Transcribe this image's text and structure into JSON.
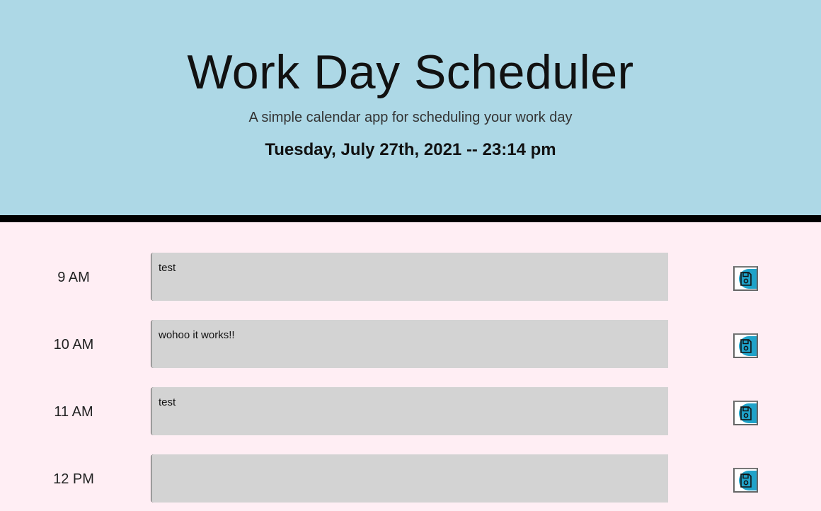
{
  "header": {
    "title": "Work Day Scheduler",
    "subtitle": "A simple calendar app for scheduling your work day",
    "current_day": "Tuesday, July 27th, 2021 -- 23:14 pm"
  },
  "rows": [
    {
      "hour": "9 AM",
      "text": "test",
      "save_icon": "floppy-disk-icon"
    },
    {
      "hour": "10 AM",
      "text": "wohoo it works!!",
      "save_icon": "floppy-disk-icon"
    },
    {
      "hour": "11 AM",
      "text": "test",
      "save_icon": "floppy-disk-icon"
    },
    {
      "hour": "12 PM",
      "text": "",
      "save_icon": "floppy-disk-icon"
    }
  ],
  "colors": {
    "header_bg": "#add8e6",
    "page_bg": "#ffeef4",
    "textarea_bg": "#d3d3d3",
    "save_accent": "#1fa2c9"
  }
}
